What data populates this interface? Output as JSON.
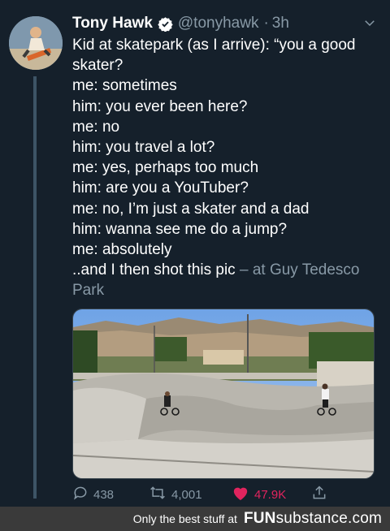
{
  "tweet": {
    "author_name": "Tony Hawk",
    "handle": "@tonyhawk",
    "separator": "·",
    "time": "3h",
    "text_lines": [
      "Kid at skatepark (as I arrive): “you a good skater?",
      "me: sometimes",
      "him: you ever been here?",
      "me: no",
      "him: you travel a lot?",
      "me: yes, perhaps too much",
      "him: are you a YouTuber?",
      "me: no, I’m just a skater and a dad",
      "him: wanna see me do a jump?",
      "me: absolutely",
      "..and I then shot this pic"
    ],
    "location_text": "– at Guy Tedesco Park",
    "replies": "438",
    "retweets": "4,001",
    "likes": "47.9K"
  },
  "footer": {
    "tagline": "Only the best stuff at",
    "brand_bold": "FUN",
    "brand_rest": "substance.com"
  },
  "colors": {
    "background": "#15202b",
    "secondary_text": "#8899a6",
    "like_red": "#e0245e",
    "verified_blue": "#1da1f2",
    "footer_bg": "#3a3a3a"
  },
  "icons": [
    "verified-badge-icon",
    "chevron-down-icon",
    "reply-icon",
    "retweet-icon",
    "heart-icon",
    "share-icon"
  ]
}
